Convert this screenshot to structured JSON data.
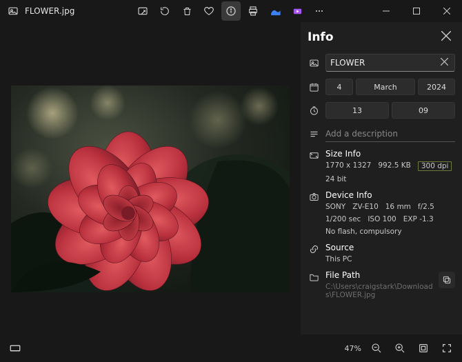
{
  "header": {
    "filename": "FLOWER.jpg"
  },
  "toolbar": {
    "icons": [
      "edit",
      "rotate",
      "delete",
      "favorite",
      "info",
      "print",
      "cloud-paint",
      "clip",
      "more"
    ]
  },
  "info": {
    "title": "Info",
    "name": "FLOWER",
    "date": {
      "day": "4",
      "month": "March",
      "year": "2024"
    },
    "time": {
      "hour": "13",
      "min": "09"
    },
    "description_placeholder": "Add a description",
    "size_label": "Size Info",
    "size": {
      "dimensions": "1770 x 1327",
      "filesize": "992.5 KB",
      "dpi": "300 dpi",
      "depth": "24 bit"
    },
    "device_label": "Device Info",
    "device": {
      "make": "SONY",
      "model": "ZV-E10",
      "focal": "16 mm",
      "aperture": "f/2.5",
      "shutter": "1/200 sec",
      "iso": "ISO 100",
      "exp": "EXP -1.3",
      "flash": "No flash, compulsory"
    },
    "source_label": "Source",
    "source": "This PC",
    "path_label": "File Path",
    "path": "C:\\Users\\craigstark\\Downloads\\FLOWER.jpg"
  },
  "bottom": {
    "zoom": "47%"
  }
}
